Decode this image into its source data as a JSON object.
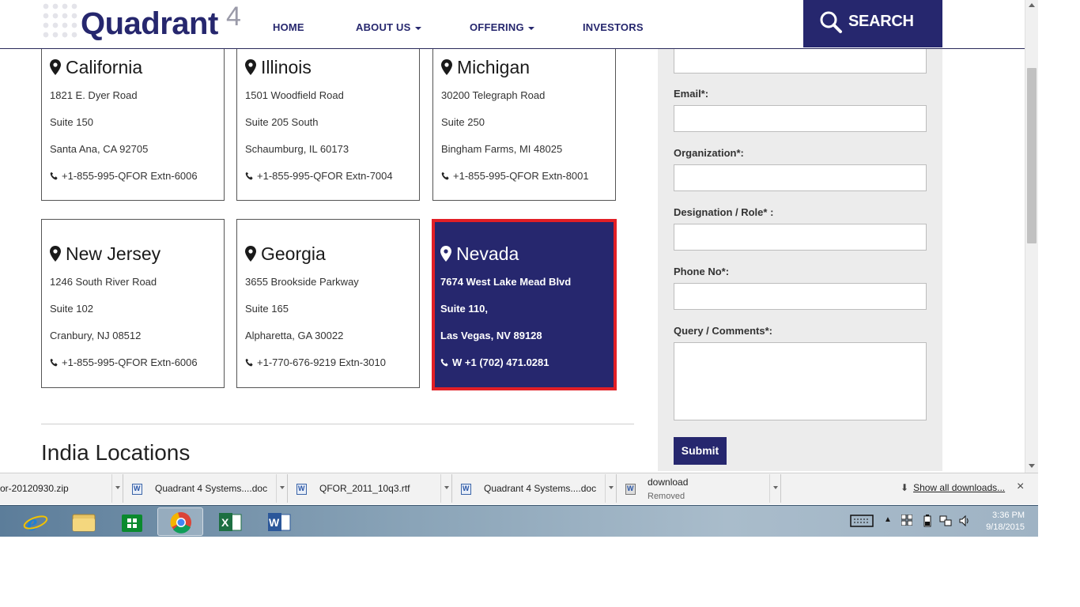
{
  "header": {
    "logo_text": "Quadrant",
    "logo_sup": "4",
    "nav": {
      "home": "HOME",
      "about": "ABOUT US",
      "offering": "OFFERING",
      "investors": "INVESTORS"
    },
    "search_label": "SEARCH"
  },
  "locations": [
    {
      "state": "California",
      "line1": "1821 E. Dyer Road",
      "line2": "Suite 150",
      "line3": "Santa Ana, CA 92705",
      "phone": "+1-855-995-QFOR Extn-6006"
    },
    {
      "state": "Illinois",
      "line1": "1501 Woodfield Road",
      "line2": "Suite 205 South",
      "line3": "Schaumburg, IL 60173",
      "phone": "+1-855-995-QFOR Extn-7004"
    },
    {
      "state": "Michigan",
      "line1": "30200 Telegraph Road",
      "line2": "Suite 250",
      "line3": "Bingham Farms, MI 48025",
      "phone": "+1-855-995-QFOR Extn-8001"
    },
    {
      "state": "New Jersey",
      "line1": "1246 South River Road",
      "line2": "Suite 102",
      "line3": "Cranbury, NJ 08512",
      "phone": "+1-855-995-QFOR Extn-6006"
    },
    {
      "state": "Georgia",
      "line1": "3655 Brookside Parkway",
      "line2": "Suite 165",
      "line3": "Alpharetta, GA 30022",
      "phone": "+1-770-676-9219 Extn-3010"
    },
    {
      "state": "Nevada",
      "line1": "7674 West Lake Mead Blvd",
      "line2": "Suite 110,",
      "line3": "Las Vegas, NV 89128",
      "phone": "W +1 (702) 471.0281"
    }
  ],
  "india_heading": "India Locations",
  "form": {
    "email_label": "Email*:",
    "org_label": "Organization*:",
    "role_label": "Designation / Role* :",
    "phone_label": "Phone No*:",
    "query_label": "Query / Comments*:",
    "submit_label": "Submit"
  },
  "downloads": {
    "items": [
      {
        "name": "or-20120930.zip"
      },
      {
        "name": "Quadrant 4 Systems....doc"
      },
      {
        "name": "QFOR_2011_10q3.rtf"
      },
      {
        "name": "Quadrant 4 Systems....doc"
      },
      {
        "name": "download",
        "status": "Removed"
      }
    ],
    "show_all": "Show all downloads...",
    "close": "×"
  },
  "taskbar": {
    "time": "3:36 PM",
    "date": "9/18/2015"
  },
  "colors": {
    "brand_navy": "#26276e",
    "highlight_red": "#e21f26"
  }
}
